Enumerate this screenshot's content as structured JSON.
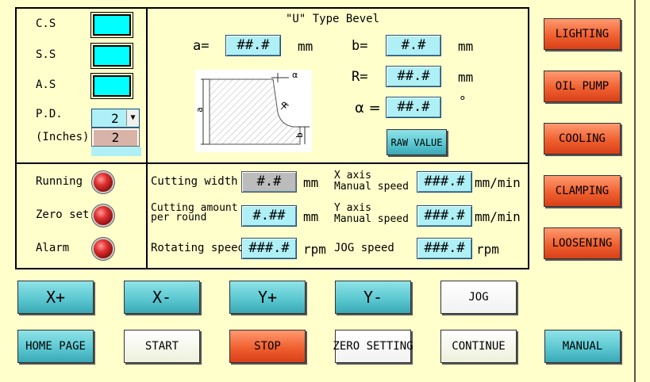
{
  "left_panel": {
    "cs_label": "C.S",
    "ss_label": "S.S",
    "as_label": "A.S",
    "pd_label": "P.D.",
    "inches_label": "(Inches)",
    "pd_selected": "2",
    "pd_option": "2"
  },
  "bevel": {
    "title": "\"U\" Type Bevel",
    "a_label": "a=",
    "a_value": "##.#",
    "a_unit": "mm",
    "b_label": "b=",
    "b_value": "#.#",
    "b_unit": "mm",
    "r_label": "R=",
    "r_value": "##.#",
    "r_unit": "mm",
    "alpha_label": "α =",
    "alpha_value": "##.#",
    "alpha_unit": "°",
    "raw_value_label": "RAW VALUE",
    "diagram_labels": {
      "a": "a",
      "b": "b",
      "r": "R",
      "alpha": "α"
    }
  },
  "status": {
    "running": "Running",
    "zero_set": "Zero set",
    "alarm": "Alarm"
  },
  "params": {
    "cutting_width_label": "Cutting width",
    "cutting_width_value": "#.#",
    "cutting_width_unit": "mm",
    "cutting_amount_label_1": "Cutting amount",
    "cutting_amount_label_2": "per round",
    "cutting_amount_value": "#.##",
    "cutting_amount_unit": "mm",
    "rotating_speed_label": "Rotating speed",
    "rotating_speed_value": "###.#",
    "rotating_speed_unit": "rpm",
    "x_axis_label_1": "X axis",
    "x_axis_label_2": "Manual speed",
    "x_axis_value": "###.#",
    "x_axis_unit": "mm/min",
    "y_axis_label_1": "Y axis",
    "y_axis_label_2": "Manual speed",
    "y_axis_value": "###.#",
    "y_axis_unit": "mm/min",
    "jog_speed_label": "JOG speed",
    "jog_speed_value": "###.#",
    "jog_speed_unit": "rpm"
  },
  "side_buttons": {
    "lighting": "LIGHTING",
    "oil_pump": "OIL PUMP",
    "cooling": "COOLING",
    "clamping": "CLAMPING",
    "loosening": "LOOSENING"
  },
  "jog_buttons": {
    "x_plus": "X+",
    "x_minus": "X-",
    "y_plus": "Y+",
    "y_minus": "Y-",
    "jog": "JOG"
  },
  "bottom_buttons": {
    "home_page": "HOME PAGE",
    "start": "START",
    "stop": "STOP",
    "zero_setting": "ZERO SETTING",
    "continue": "CONTINUE",
    "manual": "MANUAL"
  },
  "colors": {
    "background": "#ffffcc",
    "value_field": "#aef0f6",
    "indicator_on": "#00ffff",
    "lamp_red": "#e03030",
    "button_teal": "#5cc8d2",
    "button_red": "#f06030"
  }
}
